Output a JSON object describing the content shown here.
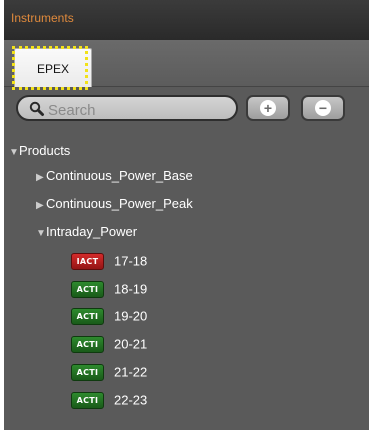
{
  "panel": {
    "title": "Instruments"
  },
  "tabs": [
    {
      "label": "EPEX",
      "selected": true,
      "highlighted": true
    }
  ],
  "search": {
    "placeholder": "Search",
    "value": ""
  },
  "toolbar": {
    "add_icon": "plus-icon",
    "remove_icon": "minus-icon"
  },
  "tree": {
    "root_label": "Products",
    "groups": [
      {
        "label": "Continuous_Power_Base",
        "expanded": false
      },
      {
        "label": "Continuous_Power_Peak",
        "expanded": false
      },
      {
        "label": "Intraday_Power",
        "expanded": true
      }
    ],
    "items": [
      {
        "label": "17-18",
        "status": "IACT"
      },
      {
        "label": "18-19",
        "status": "ACTI"
      },
      {
        "label": "19-20",
        "status": "ACTI"
      },
      {
        "label": "20-21",
        "status": "ACTI"
      },
      {
        "label": "21-22",
        "status": "ACTI"
      },
      {
        "label": "22-23",
        "status": "ACTI"
      }
    ]
  },
  "colors": {
    "title_text": "#e08a3c",
    "panel_bg": "#5a5a5a",
    "highlight": "#f2e21a",
    "status_active": "#247524",
    "status_inactive": "#c22020"
  }
}
